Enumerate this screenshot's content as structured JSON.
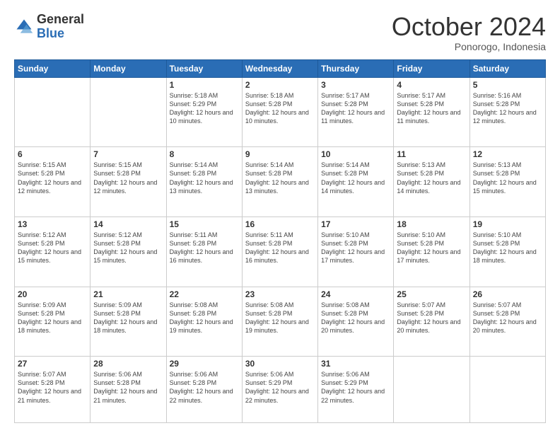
{
  "header": {
    "logo": {
      "general": "General",
      "blue": "Blue"
    },
    "title": "October 2024",
    "subtitle": "Ponorogo, Indonesia"
  },
  "days_of_week": [
    "Sunday",
    "Monday",
    "Tuesday",
    "Wednesday",
    "Thursday",
    "Friday",
    "Saturday"
  ],
  "weeks": [
    [
      {
        "day": "",
        "info": ""
      },
      {
        "day": "",
        "info": ""
      },
      {
        "day": "1",
        "info": "Sunrise: 5:18 AM\nSunset: 5:29 PM\nDaylight: 12 hours and 10 minutes."
      },
      {
        "day": "2",
        "info": "Sunrise: 5:18 AM\nSunset: 5:28 PM\nDaylight: 12 hours and 10 minutes."
      },
      {
        "day": "3",
        "info": "Sunrise: 5:17 AM\nSunset: 5:28 PM\nDaylight: 12 hours and 11 minutes."
      },
      {
        "day": "4",
        "info": "Sunrise: 5:17 AM\nSunset: 5:28 PM\nDaylight: 12 hours and 11 minutes."
      },
      {
        "day": "5",
        "info": "Sunrise: 5:16 AM\nSunset: 5:28 PM\nDaylight: 12 hours and 12 minutes."
      }
    ],
    [
      {
        "day": "6",
        "info": "Sunrise: 5:15 AM\nSunset: 5:28 PM\nDaylight: 12 hours and 12 minutes."
      },
      {
        "day": "7",
        "info": "Sunrise: 5:15 AM\nSunset: 5:28 PM\nDaylight: 12 hours and 12 minutes."
      },
      {
        "day": "8",
        "info": "Sunrise: 5:14 AM\nSunset: 5:28 PM\nDaylight: 12 hours and 13 minutes."
      },
      {
        "day": "9",
        "info": "Sunrise: 5:14 AM\nSunset: 5:28 PM\nDaylight: 12 hours and 13 minutes."
      },
      {
        "day": "10",
        "info": "Sunrise: 5:14 AM\nSunset: 5:28 PM\nDaylight: 12 hours and 14 minutes."
      },
      {
        "day": "11",
        "info": "Sunrise: 5:13 AM\nSunset: 5:28 PM\nDaylight: 12 hours and 14 minutes."
      },
      {
        "day": "12",
        "info": "Sunrise: 5:13 AM\nSunset: 5:28 PM\nDaylight: 12 hours and 15 minutes."
      }
    ],
    [
      {
        "day": "13",
        "info": "Sunrise: 5:12 AM\nSunset: 5:28 PM\nDaylight: 12 hours and 15 minutes."
      },
      {
        "day": "14",
        "info": "Sunrise: 5:12 AM\nSunset: 5:28 PM\nDaylight: 12 hours and 15 minutes."
      },
      {
        "day": "15",
        "info": "Sunrise: 5:11 AM\nSunset: 5:28 PM\nDaylight: 12 hours and 16 minutes."
      },
      {
        "day": "16",
        "info": "Sunrise: 5:11 AM\nSunset: 5:28 PM\nDaylight: 12 hours and 16 minutes."
      },
      {
        "day": "17",
        "info": "Sunrise: 5:10 AM\nSunset: 5:28 PM\nDaylight: 12 hours and 17 minutes."
      },
      {
        "day": "18",
        "info": "Sunrise: 5:10 AM\nSunset: 5:28 PM\nDaylight: 12 hours and 17 minutes."
      },
      {
        "day": "19",
        "info": "Sunrise: 5:10 AM\nSunset: 5:28 PM\nDaylight: 12 hours and 18 minutes."
      }
    ],
    [
      {
        "day": "20",
        "info": "Sunrise: 5:09 AM\nSunset: 5:28 PM\nDaylight: 12 hours and 18 minutes."
      },
      {
        "day": "21",
        "info": "Sunrise: 5:09 AM\nSunset: 5:28 PM\nDaylight: 12 hours and 18 minutes."
      },
      {
        "day": "22",
        "info": "Sunrise: 5:08 AM\nSunset: 5:28 PM\nDaylight: 12 hours and 19 minutes."
      },
      {
        "day": "23",
        "info": "Sunrise: 5:08 AM\nSunset: 5:28 PM\nDaylight: 12 hours and 19 minutes."
      },
      {
        "day": "24",
        "info": "Sunrise: 5:08 AM\nSunset: 5:28 PM\nDaylight: 12 hours and 20 minutes."
      },
      {
        "day": "25",
        "info": "Sunrise: 5:07 AM\nSunset: 5:28 PM\nDaylight: 12 hours and 20 minutes."
      },
      {
        "day": "26",
        "info": "Sunrise: 5:07 AM\nSunset: 5:28 PM\nDaylight: 12 hours and 20 minutes."
      }
    ],
    [
      {
        "day": "27",
        "info": "Sunrise: 5:07 AM\nSunset: 5:28 PM\nDaylight: 12 hours and 21 minutes."
      },
      {
        "day": "28",
        "info": "Sunrise: 5:06 AM\nSunset: 5:28 PM\nDaylight: 12 hours and 21 minutes."
      },
      {
        "day": "29",
        "info": "Sunrise: 5:06 AM\nSunset: 5:28 PM\nDaylight: 12 hours and 22 minutes."
      },
      {
        "day": "30",
        "info": "Sunrise: 5:06 AM\nSunset: 5:29 PM\nDaylight: 12 hours and 22 minutes."
      },
      {
        "day": "31",
        "info": "Sunrise: 5:06 AM\nSunset: 5:29 PM\nDaylight: 12 hours and 22 minutes."
      },
      {
        "day": "",
        "info": ""
      },
      {
        "day": "",
        "info": ""
      }
    ]
  ]
}
